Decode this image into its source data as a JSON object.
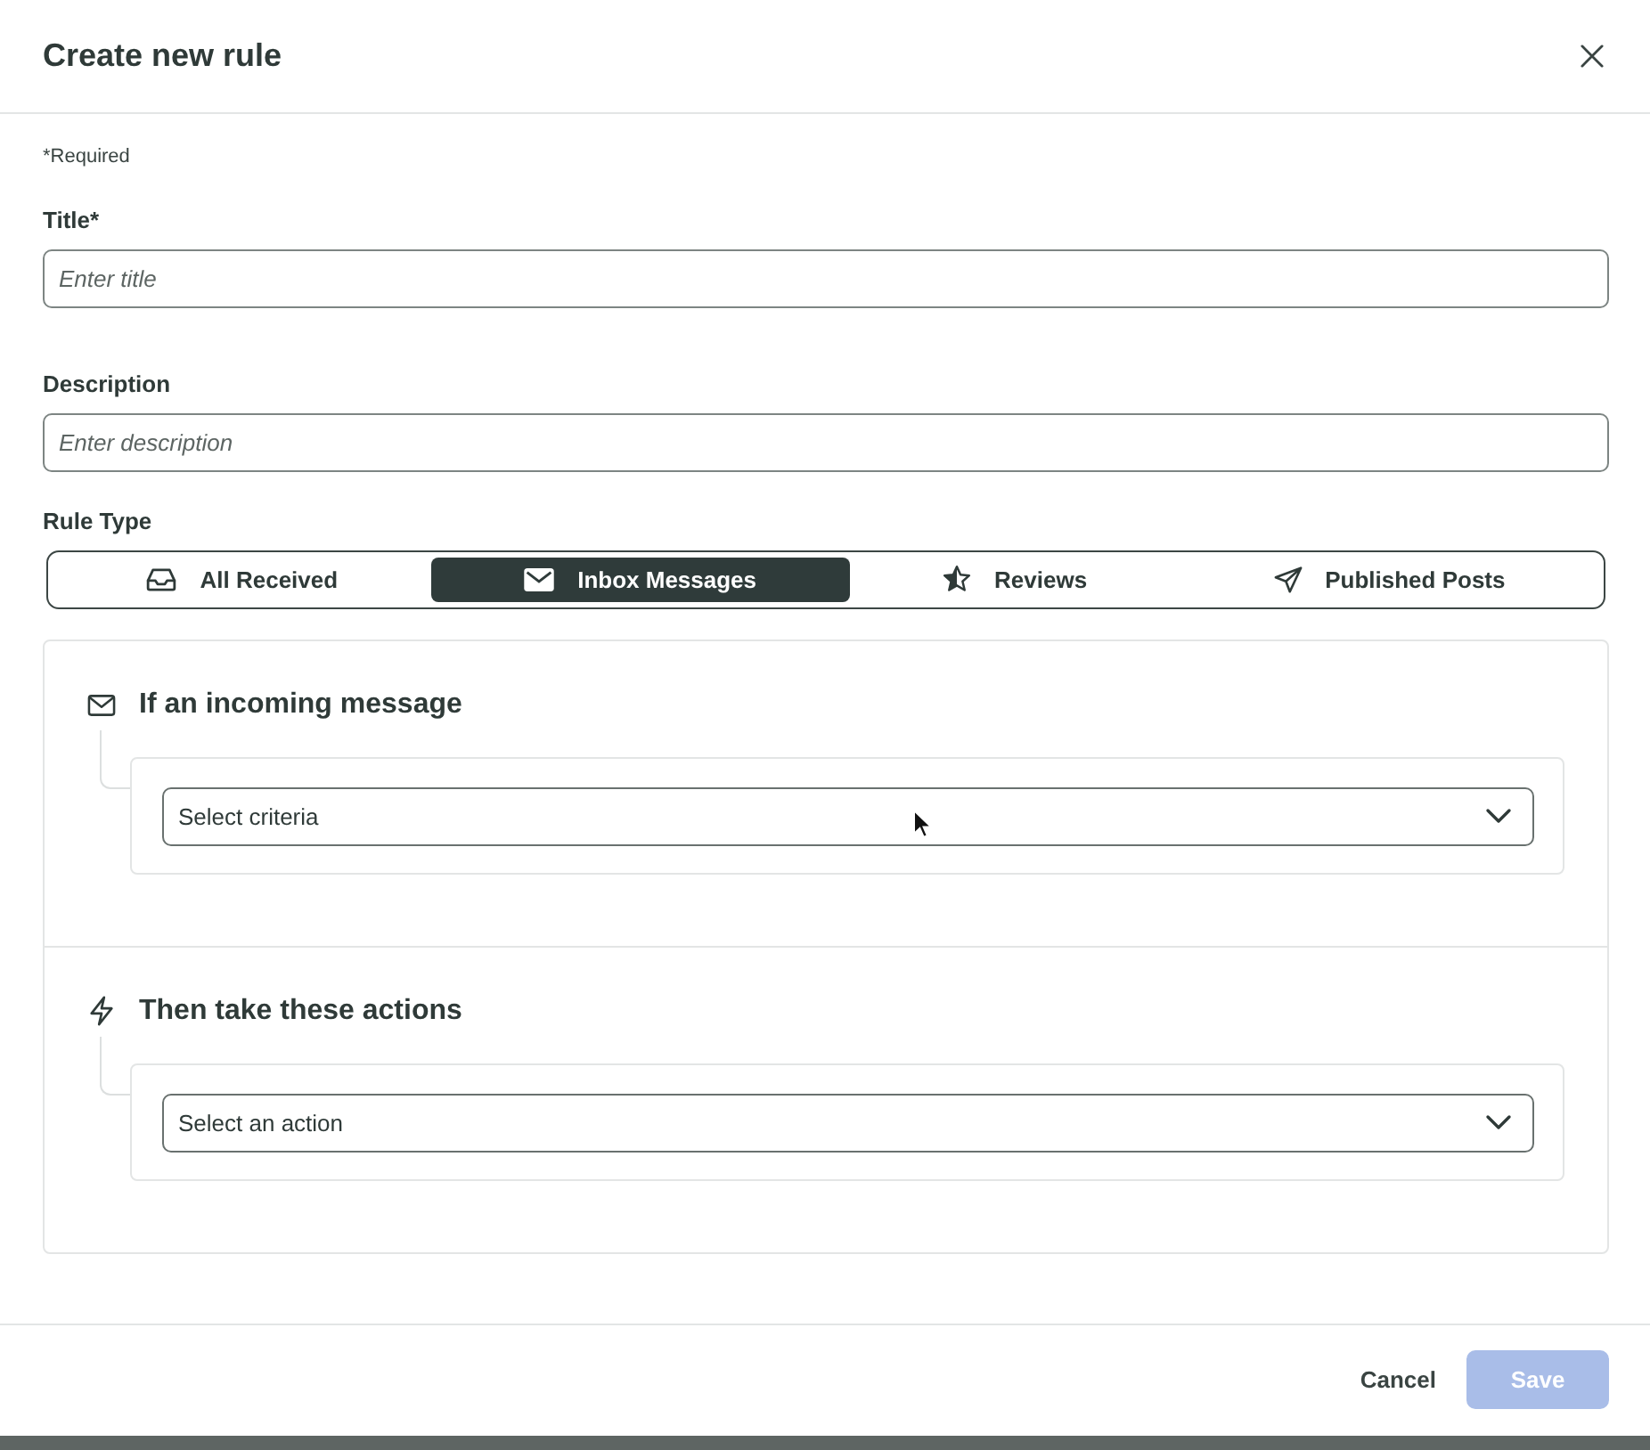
{
  "dialog": {
    "title": "Create new rule"
  },
  "required_note": "*Required",
  "fields": [
    {
      "label": "Title*",
      "placeholder": "Enter title"
    },
    {
      "label": "Description",
      "placeholder": "Enter description"
    }
  ],
  "rule_type": {
    "label": "Rule Type",
    "tabs": [
      {
        "label": "All Received",
        "selected": false
      },
      {
        "label": "Inbox Messages",
        "selected": true
      },
      {
        "label": "Reviews",
        "selected": false
      },
      {
        "label": "Published Posts",
        "selected": false
      }
    ]
  },
  "sections": [
    {
      "kind": "condition",
      "heading": "If an incoming message",
      "select": {
        "placeholder": "Select criteria"
      }
    },
    {
      "kind": "action",
      "heading": "Then take these actions",
      "select": {
        "placeholder": "Select an action"
      }
    }
  ],
  "footer": {
    "buttons": [
      {
        "label": "Cancel",
        "kind": "secondary",
        "disabled": false
      },
      {
        "label": "Save",
        "kind": "primary",
        "disabled": true
      }
    ]
  }
}
